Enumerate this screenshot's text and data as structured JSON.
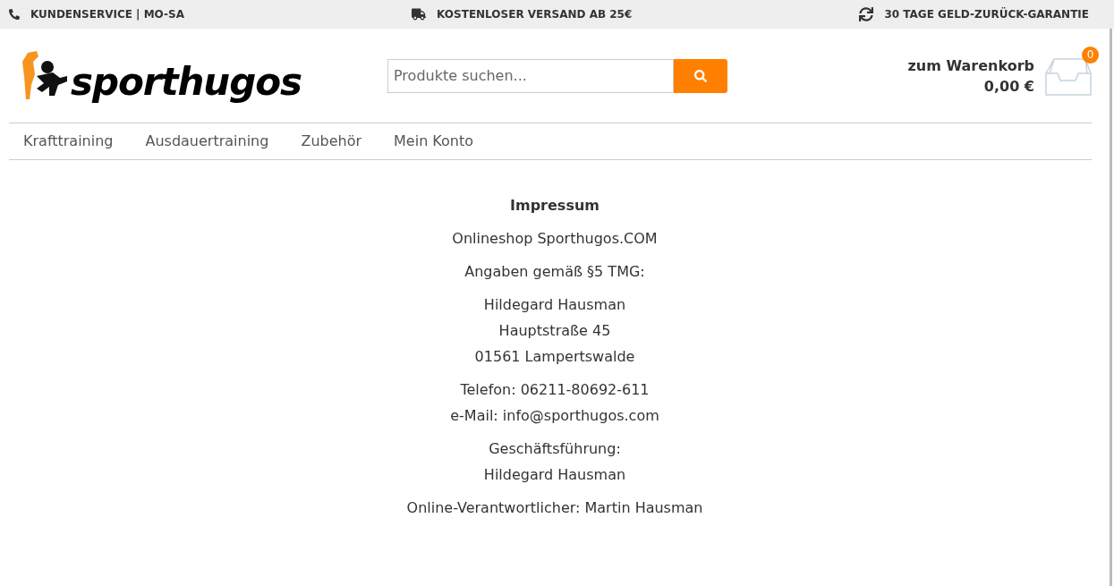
{
  "top_bar": [
    {
      "kind": "phone",
      "text": "KUNDENSERVICE | MO-SA"
    },
    {
      "kind": "truck",
      "text": "KOSTENLOSER VERSAND AB 25€"
    },
    {
      "kind": "refresh",
      "text": "30 TAGE GELD-ZURÜCK-GARANTIE"
    }
  ],
  "logo": {
    "text": "sporthugos"
  },
  "search": {
    "placeholder": "Produkte suchen..."
  },
  "cart": {
    "label": "zum Warenkorb",
    "total": "0,00 €",
    "count": "0"
  },
  "nav": [
    "Krafttraining",
    "Ausdauertraining",
    "Zubehör",
    "Mein Konto"
  ],
  "content": {
    "title": "Impressum",
    "paragraphs": [
      [
        "Onlineshop Sporthugos.COM"
      ],
      [
        "Angaben gemäß §5 TMG:"
      ],
      [
        "Hildegard Hausman",
        "Hauptstraße 45",
        "01561 Lampertswalde"
      ],
      [
        "Telefon: 06211-80692-611",
        "e-Mail: info@sporthugos.com"
      ],
      [
        "Geschäftsführung:",
        "Hildegard Hausman"
      ],
      [
        "Online-Verantwortlicher: Martin Hausman"
      ]
    ]
  }
}
